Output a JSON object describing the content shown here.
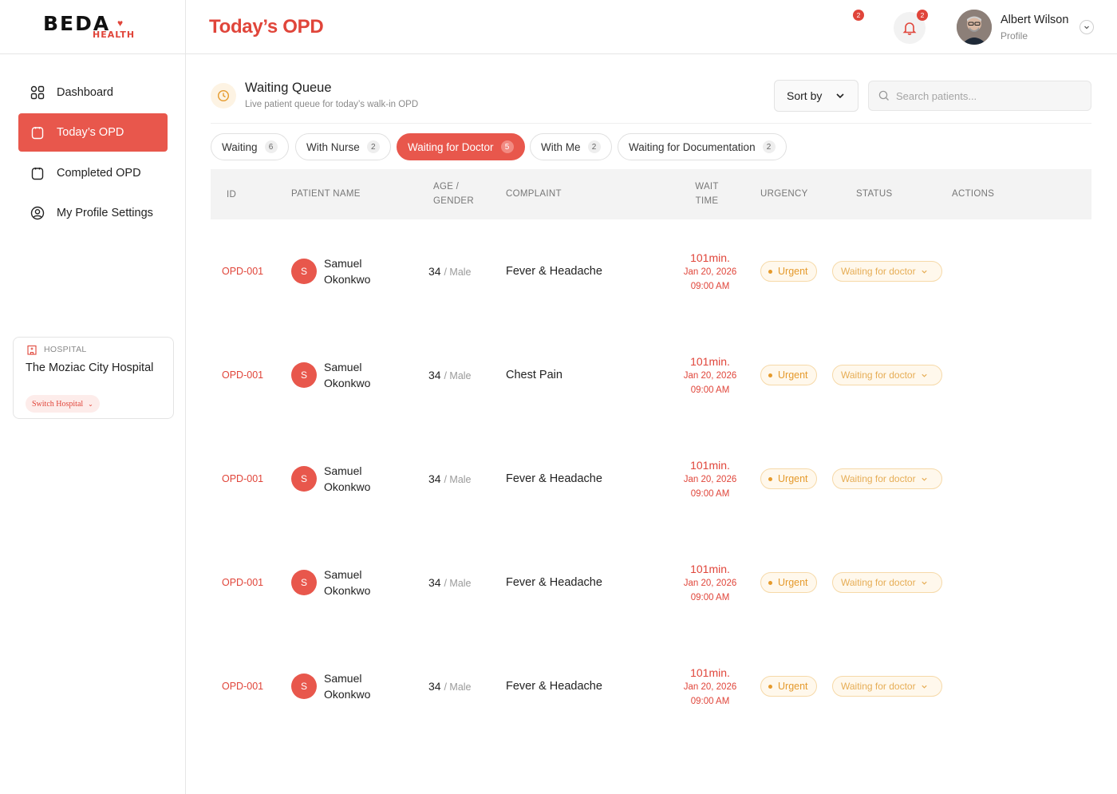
{
  "brand": {
    "name": "BEDA",
    "sub": "HEALTH"
  },
  "header": {
    "title": "Today’s OPD",
    "alert_badge": "2",
    "bell_badge": "2",
    "user": {
      "name": "Albert Wilson",
      "role": "Profile"
    }
  },
  "sidebar": {
    "items": [
      {
        "label": "Dashboard",
        "icon": "grid-icon"
      },
      {
        "label": "Today’s OPD",
        "icon": "clipboard-icon",
        "active": true
      },
      {
        "label": "Completed OPD",
        "icon": "clipboard-icon"
      },
      {
        "label": "My Profile Settings",
        "icon": "user-circle-icon"
      }
    ],
    "hospital": {
      "label": "HOSPITAL",
      "name": "The Moziac City Hospital",
      "switch_label": "Switch Hospital"
    }
  },
  "queue": {
    "title": "Waiting Queue",
    "subtitle": "Live patient queue for today’s walk-in OPD",
    "sort_label": "Sort by",
    "search_placeholder": "Search patients..."
  },
  "tabs": [
    {
      "label": "Waiting",
      "count": "6"
    },
    {
      "label": "With Nurse",
      "count": "2"
    },
    {
      "label": "Waiting for Doctor",
      "count": "5",
      "active": true
    },
    {
      "label": "With Me",
      "count": "2"
    },
    {
      "label": "Waiting for Documentation",
      "count": "2"
    }
  ],
  "table": {
    "headers": {
      "id": "ID",
      "patient": "PATIENT NAME",
      "age_1": "AGE /",
      "age_2": "GENDER",
      "complaint": "COMPLAINT",
      "wait_1": "WAIT",
      "wait_2": "TIME",
      "urgency": "URGENCY",
      "status": "STATUS",
      "actions": "ACTIONS"
    },
    "rows": [
      {
        "id": "OPD-001",
        "initial": "S",
        "first": "Samuel",
        "last": "Okonkwo",
        "age": "34",
        "gender": "/ Male",
        "complaint": "Fever & Headache",
        "wait": "101min.",
        "date": "Jan 20, 2026",
        "time": "09:00 AM",
        "urgency": "Urgent",
        "status": "Waiting for doctor"
      },
      {
        "id": "OPD-001",
        "initial": "S",
        "first": "Samuel",
        "last": "Okonkwo",
        "age": "34",
        "gender": "/ Male",
        "complaint": "Chest Pain",
        "wait": "101min.",
        "date": "Jan 20, 2026",
        "time": "09:00 AM",
        "urgency": "Urgent",
        "status": "Waiting for doctor"
      },
      {
        "id": "OPD-001",
        "initial": "S",
        "first": "Samuel",
        "last": "Okonkwo",
        "age": "34",
        "gender": "/ Male",
        "complaint": "Fever & Headache",
        "wait": "101min.",
        "date": "Jan 20, 2026",
        "time": "09:00 AM",
        "urgency": "Urgent",
        "status": "Waiting for doctor"
      },
      {
        "id": "OPD-001",
        "initial": "S",
        "first": "Samuel",
        "last": "Okonkwo",
        "age": "34",
        "gender": "/ Male",
        "complaint": "Fever & Headache",
        "wait": "101min.",
        "date": "Jan 20, 2026",
        "time": "09:00 AM",
        "urgency": "Urgent",
        "status": "Waiting for doctor"
      },
      {
        "id": "OPD-001",
        "initial": "S",
        "first": "Samuel",
        "last": "Okonkwo",
        "age": "34",
        "gender": "/ Male",
        "complaint": "Fever & Headache",
        "wait": "101min.",
        "date": "Jan 20, 2026",
        "time": "09:00 AM",
        "urgency": "Urgent",
        "status": "Waiting for doctor"
      }
    ]
  },
  "colors": {
    "accent": "#e8574c",
    "accent_text": "#e0453a",
    "warning": "#e59a2c",
    "warning_bg": "#fff8ec"
  }
}
